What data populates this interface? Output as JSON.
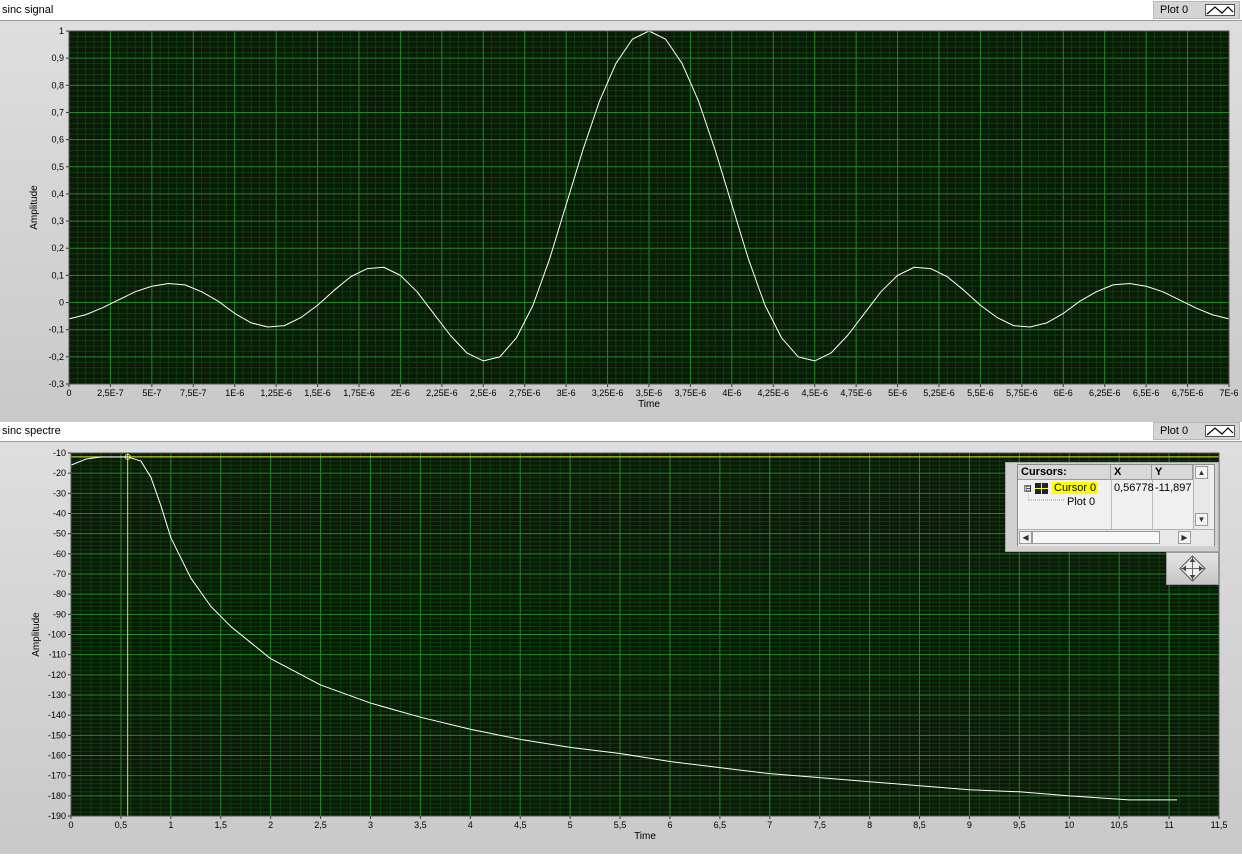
{
  "graphs": [
    {
      "caption": "sinc signal",
      "legend_label": "Plot 0",
      "chart_data": {
        "type": "line",
        "title": "sinc signal",
        "xlabel": "Time",
        "ylabel": "Amplitude",
        "xlim": [
          0,
          7e-06
        ],
        "ylim": [
          -0.3,
          1
        ],
        "x_tick_labels": [
          "0",
          "2,5E-7",
          "5E-7",
          "7,5E-7",
          "1E-6",
          "1,25E-6",
          "1,5E-6",
          "1,75E-6",
          "2E-6",
          "2,25E-6",
          "2,5E-6",
          "2,75E-6",
          "3E-6",
          "3,25E-6",
          "3,5E-6",
          "3,75E-6",
          "4E-6",
          "4,25E-6",
          "4,5E-6",
          "4,75E-6",
          "5E-6",
          "5,25E-6",
          "5,5E-6",
          "5,75E-6",
          "6E-6",
          "6,25E-6",
          "6,5E-6",
          "6,75E-6",
          "7E-6"
        ],
        "y_tick_labels": [
          "1",
          "0,9",
          "0,8",
          "0,7",
          "0,6",
          "0,5",
          "0,4",
          "0,3",
          "0,2",
          "0,1",
          "0",
          "-0,1",
          "-0,2",
          "-0,3"
        ],
        "grid": true,
        "legend": "top-right",
        "colors": {
          "background": "#0a1a06",
          "major_grid": "#1f8a26",
          "minor_grid": "#0e3e10",
          "line": "#ffffff"
        },
        "series": [
          {
            "name": "Plot 0",
            "x": [
              0,
              1e-07,
              2e-07,
              3e-07,
              4e-07,
              5e-07,
              6e-07,
              7e-07,
              8e-07,
              9e-07,
              1e-06,
              1.1e-06,
              1.2e-06,
              1.3e-06,
              1.4e-06,
              1.5e-06,
              1.6e-06,
              1.7e-06,
              1.8e-06,
              1.9e-06,
              2e-06,
              2.1e-06,
              2.2e-06,
              2.3e-06,
              2.4e-06,
              2.5e-06,
              2.6e-06,
              2.7e-06,
              2.8e-06,
              2.9e-06,
              3e-06,
              3.1e-06,
              3.2e-06,
              3.3e-06,
              3.4e-06,
              3.5e-06,
              3.6e-06,
              3.7e-06,
              3.8e-06,
              3.9e-06,
              4e-06,
              4.1e-06,
              4.2e-06,
              4.3e-06,
              4.4e-06,
              4.5e-06,
              4.6e-06,
              4.7e-06,
              4.8e-06,
              4.9e-06,
              5e-06,
              5.1e-06,
              5.2e-06,
              5.3e-06,
              5.4e-06,
              5.5e-06,
              5.6e-06,
              5.7e-06,
              5.8e-06,
              5.9e-06,
              6e-06,
              6.1e-06,
              6.2e-06,
              6.3e-06,
              6.4e-06,
              6.5e-06,
              6.6e-06,
              6.7e-06,
              6.8e-06,
              6.9e-06,
              7e-06
            ],
            "y": [
              -0.06,
              -0.045,
              -0.02,
              0.01,
              0.04,
              0.06,
              0.07,
              0.065,
              0.04,
              0.005,
              -0.04,
              -0.075,
              -0.09,
              -0.085,
              -0.055,
              -0.01,
              0.045,
              0.095,
              0.125,
              0.13,
              0.1,
              0.04,
              -0.04,
              -0.12,
              -0.185,
              -0.215,
              -0.2,
              -0.13,
              -0.01,
              0.16,
              0.36,
              0.56,
              0.74,
              0.88,
              0.97,
              1.0,
              0.97,
              0.88,
              0.74,
              0.56,
              0.36,
              0.16,
              -0.01,
              -0.13,
              -0.2,
              -0.215,
              -0.185,
              -0.12,
              -0.04,
              0.04,
              0.1,
              0.13,
              0.125,
              0.095,
              0.045,
              -0.01,
              -0.055,
              -0.085,
              -0.09,
              -0.075,
              -0.04,
              0.005,
              0.04,
              0.065,
              0.07,
              0.06,
              0.04,
              0.01,
              -0.02,
              -0.045,
              -0.06
            ]
          }
        ]
      }
    },
    {
      "caption": "sinc spectre",
      "legend_label": "Plot 0",
      "chart_data": {
        "type": "line",
        "title": "sinc spectre",
        "xlabel": "Time",
        "ylabel": "Amplitude",
        "xlim": [
          0,
          11.5
        ],
        "ylim": [
          -190,
          -10
        ],
        "x_tick_labels": [
          "0",
          "0,5",
          "1",
          "1,5",
          "2",
          "2,5",
          "3",
          "3,5",
          "4",
          "4,5",
          "5",
          "5,5",
          "6",
          "6,5",
          "7",
          "7,5",
          "8",
          "8,5",
          "9",
          "9,5",
          "10",
          "10,5",
          "11",
          "11,5"
        ],
        "y_tick_labels": [
          "-10",
          "-20",
          "-30",
          "-40",
          "-50",
          "-60",
          "-70",
          "-80",
          "-90",
          "-100",
          "-110",
          "-120",
          "-130",
          "-140",
          "-150",
          "-160",
          "-170",
          "-180",
          "-190"
        ],
        "grid": true,
        "legend": "top-right",
        "colors": {
          "background": "#0a1a06",
          "major_grid": "#1f8a26",
          "minor_grid": "#0e3e10",
          "line": "#ffffff",
          "cursor": "#e8e830"
        },
        "series": [
          {
            "name": "Plot 0",
            "x": [
              0,
              0.15,
              0.3,
              0.45,
              0.56778,
              0.7,
              0.8,
              0.9,
              1.0,
              1.2,
              1.4,
              1.6,
              1.8,
              2.0,
              2.5,
              3.0,
              3.5,
              4.0,
              4.5,
              5.0,
              5.5,
              6.0,
              6.5,
              7.0,
              7.5,
              8.0,
              8.5,
              9.0,
              9.5,
              10.0,
              10.6,
              11.08
            ],
            "y": [
              -16,
              -13,
              -12,
              -12,
              -11.897,
              -14,
              -22,
              -36,
              -52,
              -72,
              -86,
              -96,
              -104,
              -112,
              -125,
              -134,
              -141,
              -147,
              -152,
              -156,
              -159,
              -163,
              -166,
              -169,
              -171,
              -173,
              -175,
              -177,
              -178,
              -180,
              -182,
              -182
            ]
          }
        ],
        "cursor": {
          "name": "Cursor 0",
          "plot": "Plot 0",
          "x": 0.56778,
          "y": -11.897,
          "x_label": "0,56778",
          "y_label": "-11,897"
        }
      }
    }
  ],
  "cursor_legend": {
    "header": "Cursors:",
    "col_x": "X",
    "col_y": "Y",
    "cursor_name": "Cursor 0",
    "cursor_x": "0,56778",
    "cursor_y": "-11,897",
    "plot_name": "Plot 0",
    "expander": "⊟"
  }
}
